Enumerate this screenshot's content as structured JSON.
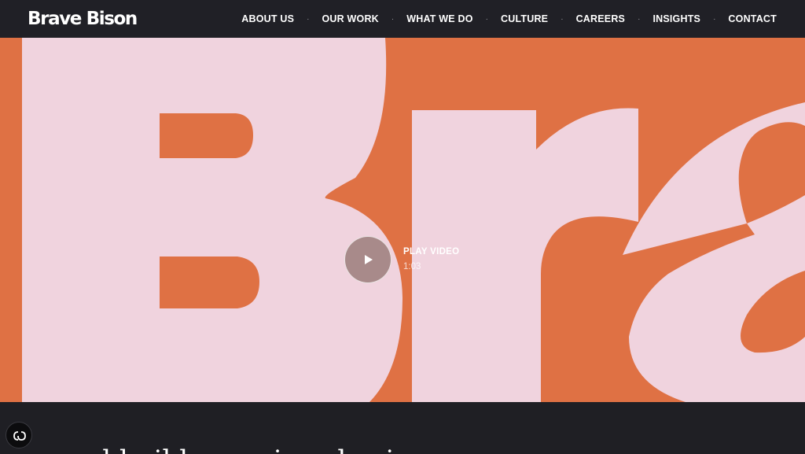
{
  "brand": {
    "name": "Brave Bison"
  },
  "nav": {
    "items": [
      {
        "label": "ABOUT US"
      },
      {
        "label": "OUR WORK"
      },
      {
        "label": "WHAT WE DO"
      },
      {
        "label": "CULTURE"
      },
      {
        "label": "CAREERS"
      },
      {
        "label": "INSIGHTS"
      },
      {
        "label": "CONTACT"
      }
    ],
    "separator": "·"
  },
  "hero": {
    "play_label": "PLAY VIDEO",
    "duration": "1:03",
    "background_color": "#df7144",
    "letter_color": "#f0d3de"
  },
  "intro": {
    "text": "... and build conscious business"
  },
  "icons": {
    "play": "play-icon",
    "cookie": "cookie-settings-icon"
  }
}
